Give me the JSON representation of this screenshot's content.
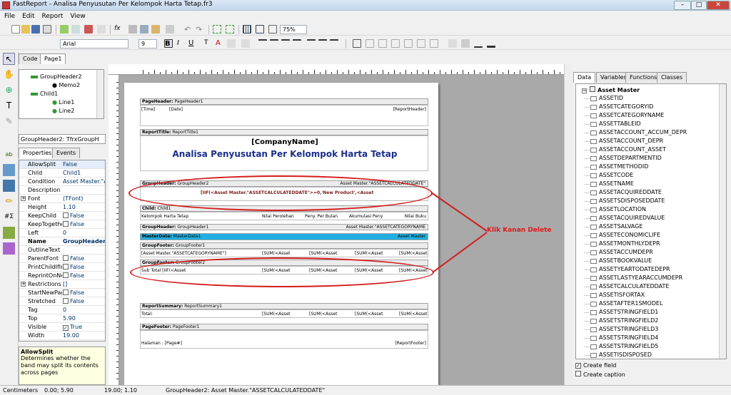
{
  "window": {
    "title": "FastReport - Analisa Penyusutan Per Kelompok Harta Tetap.fr3"
  },
  "menu": [
    "File",
    "Edit",
    "Report",
    "View"
  ],
  "toolbar": {
    "zoom": "75%",
    "font_name": "Arial",
    "font_size": "9"
  },
  "tabs": {
    "code": "Code",
    "page": "Page1"
  },
  "tree": [
    "GroupHeader2",
    "Memo2",
    "Child1",
    "Line1",
    "Line2"
  ],
  "object_combo": "GroupHeader2: TfrxGroupH",
  "inspector_tabs": {
    "properties": "Properties",
    "events": "Events"
  },
  "properties": [
    {
      "name": "AllowSplit",
      "value": "False"
    },
    {
      "name": "Child",
      "value": "Child1"
    },
    {
      "name": "Condition",
      "value": "Asset Master.\"A"
    },
    {
      "name": "Description",
      "value": ""
    },
    {
      "name": "Font",
      "value": "(TFont)",
      "expand": true
    },
    {
      "name": "Height",
      "value": "1.10"
    },
    {
      "name": "KeepChild",
      "value": "False",
      "check": true
    },
    {
      "name": "KeepTogethe",
      "value": "False",
      "check": true
    },
    {
      "name": "Left",
      "value": "0"
    },
    {
      "name": "Name",
      "value": "GroupHeader2",
      "bold": true
    },
    {
      "name": "OutlineText",
      "value": ""
    },
    {
      "name": "ParentFont",
      "value": "False",
      "check": true
    },
    {
      "name": "PrintChildIfIn",
      "value": "False",
      "check": true
    },
    {
      "name": "ReprintOnNe",
      "value": "False",
      "check": true
    },
    {
      "name": "Restrictions",
      "value": "[]",
      "expand": true
    },
    {
      "name": "StartNewPag",
      "value": "False",
      "check": true
    },
    {
      "name": "Stretched",
      "value": "False",
      "check": true
    },
    {
      "name": "Tag",
      "value": "0"
    },
    {
      "name": "Top",
      "value": "5.90"
    },
    {
      "name": "Visible",
      "value": "True",
      "check": true,
      "checked": true
    },
    {
      "name": "Width",
      "value": "19.00"
    }
  ],
  "help": {
    "title": "AllowSplit",
    "text": "Determines whether the band may split its contents across pages"
  },
  "report": {
    "page_header": {
      "label": "PageHeader:",
      "name": "PageHeader1",
      "time": "[Time]",
      "date": "[Date]",
      "right": "[ReportHeader]"
    },
    "report_title": {
      "label": "ReportTitle:",
      "name": "ReportTitle1",
      "company": "[CompanyName]",
      "title": "Analisa Penyusutan Per Kelompok Harta Tetap"
    },
    "group_header2": {
      "label": "GroupHeader:",
      "name": "GroupHeader2",
      "cond": "Asset Master.\"ASSETCALCULATEDDATE\"",
      "memo": "[IIF(<Asset Master.\"ASSETCALCULATEDDATE\">=0,'New Product',<Asset"
    },
    "child": {
      "label": "Child:",
      "name": "Child1",
      "cols": [
        "Kelompok Harta Tetap",
        "Nilai Perolehan",
        "Peny. Per Bulan",
        "Akumulasi Peny",
        "Nilai Buku"
      ]
    },
    "group_header1": {
      "label": "GroupHeader:",
      "name": "GroupHeader1",
      "cond": "Asset Master.\"ASSETCATEGORYNAME"
    },
    "master_data": {
      "label": "MasterData:",
      "name": "MasterData1",
      "ds": "Asset Master"
    },
    "group_footer1": {
      "label": "GroupFooter:",
      "name": "GroupFooter1",
      "c1": "[Asset Master.\"ASSETCATEGORYNAME\"]",
      "sum": "[SUM(<Asset"
    },
    "group_footer2": {
      "label": "GroupFooter:",
      "name": "GroupFooter2",
      "c1": "Sub Total [IIF(<Asset",
      "sum": "[SUM(<Asset"
    },
    "report_summary": {
      "label": "ReportSummary:",
      "name": "ReportSummary1",
      "c1": "Total:",
      "sum": "[SUM(<Asset"
    },
    "page_footer": {
      "label": "PageFooter:",
      "name": "PageFooter1",
      "c1": "Halaman : [Page#]",
      "right": "[ReportFooter]"
    }
  },
  "annotation": "Klik Kanan Delete",
  "data_tabs": [
    "Data",
    "Variables",
    "Functions",
    "Classes"
  ],
  "dataset": "Asset Master",
  "fields": [
    "ASSETID",
    "ASSETCATEGORYID",
    "ASSETCATEGORYNAME",
    "ASSETTABLEID",
    "ASSETACCOUNT_ACCUM_DEPR",
    "ASSETACCOUNT_DEPR",
    "ASSETACCOUNT_ASSET",
    "ASSETDEPARTMENTID",
    "ASSETMETHODID",
    "ASSETCODE",
    "ASSETNAME",
    "ASSETACQUIREDDATE",
    "ASSETSDISPOSEDDATE",
    "ASSETLOCATION",
    "ASSETACQUIREDVALUE",
    "ASSETSALVAGE",
    "ASSETECONOMICLIFE",
    "ASSETMONTHLYDEPR",
    "ASSETACCUMDEPR",
    "ASSETBOOKVALUE",
    "ASSETYEARTODATEDEPR",
    "ASSETLASTYEARACCUMDEPR",
    "ASSETCALCULATEDDATE",
    "ASSETISFORTAX",
    "ASSETAFTER1SMODEL",
    "ASSETSTRINGFIELD1",
    "ASSETSTRINGFIELD2",
    "ASSETSTRINGFIELD3",
    "ASSETSTRINGFIELD4",
    "ASSETSTRINGFIELD5",
    "ASSETISDISPOSED"
  ],
  "options": {
    "create_field": "Create field",
    "create_field_checked": true,
    "create_caption": "Create caption",
    "create_caption_checked": false
  },
  "status": {
    "units": "Centimeters",
    "pos": "0.00; 5.90",
    "size": "19.00; 1.10",
    "text": "GroupHeader2: Asset Master.\"ASSETCALCULATEDDATE\""
  }
}
